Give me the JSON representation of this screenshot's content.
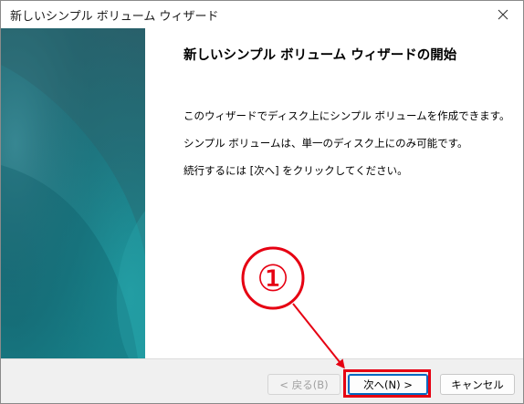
{
  "window": {
    "title": "新しいシンプル ボリューム ウィザード"
  },
  "content": {
    "heading": "新しいシンプル ボリューム ウィザードの開始",
    "paragraphs": [
      "このウィザードでディスク上にシンプル ボリュームを作成できます。",
      "シンプル ボリュームは、単一のディスク上にのみ可能です。",
      "続行するには [次へ] をクリックしてください。"
    ]
  },
  "buttons": {
    "back": "< 戻る(B)",
    "next": "次へ(N) >",
    "cancel": "キャンセル"
  },
  "annotation": {
    "label": "①",
    "color": "#e60012"
  },
  "icons": {
    "close": "close-icon"
  }
}
